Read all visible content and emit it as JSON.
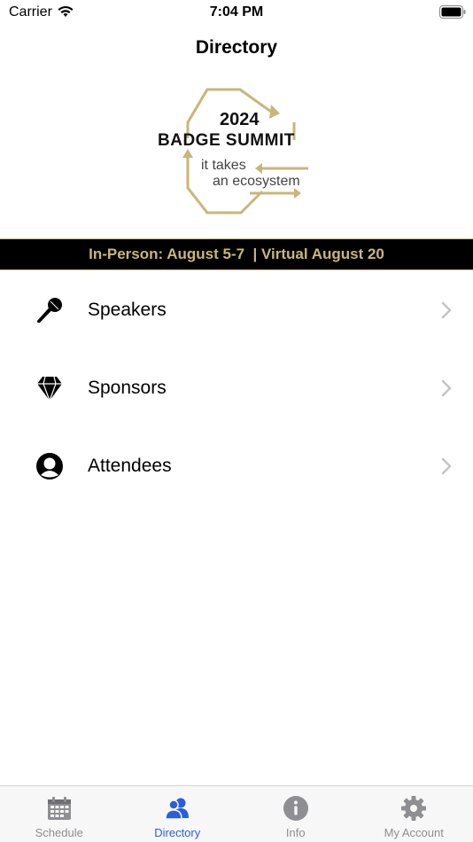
{
  "status_bar": {
    "carrier": "Carrier",
    "time": "7:04 PM"
  },
  "nav": {
    "title": "Directory"
  },
  "logo": {
    "year": "2024",
    "name": "BADGE SUMMIT",
    "tagline_1": "it takes",
    "tagline_2": "an ecosystem",
    "accent_color": "#c9b67a"
  },
  "banner": {
    "text": "In-Person: August 5-7  | Virtual August 20",
    "color": "#c9b67a",
    "background": "#000000"
  },
  "directory": {
    "items": [
      {
        "label": "Speakers",
        "icon": "microphone-icon"
      },
      {
        "label": "Sponsors",
        "icon": "diamond-icon"
      },
      {
        "label": "Attendees",
        "icon": "person-circle-icon"
      }
    ]
  },
  "tabs": [
    {
      "label": "Schedule",
      "icon": "calendar-icon"
    },
    {
      "label": "Directory",
      "icon": "people-icon",
      "active": true
    },
    {
      "label": "Info",
      "icon": "info-icon"
    },
    {
      "label": "My Account",
      "icon": "gear-icon"
    }
  ],
  "colors": {
    "active_tab": "#2b5fd9",
    "inactive_tab": "#8e8e93"
  }
}
